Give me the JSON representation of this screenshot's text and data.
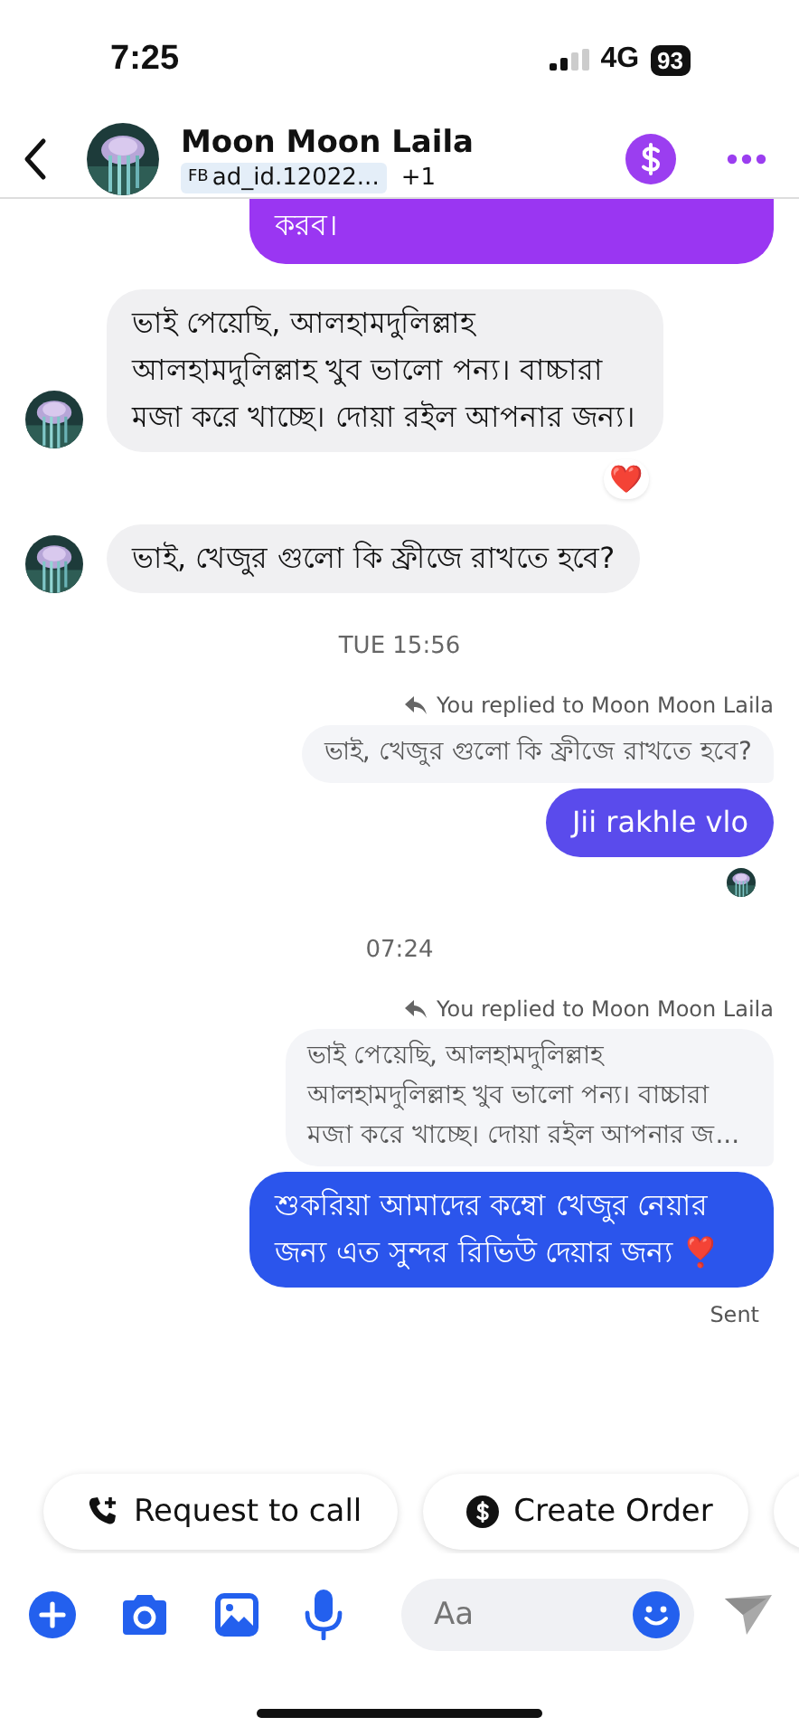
{
  "status_bar": {
    "time": "7:25",
    "network": "4G",
    "battery": "93"
  },
  "header": {
    "name": "Moon Moon Laila",
    "tag_prefix": "FB",
    "tag": "ad_id.12022...",
    "extra": "+1"
  },
  "messages": [
    {
      "kind": "outgoing",
      "text": "করব।",
      "color": "#9a36f2",
      "cut_top": true
    },
    {
      "kind": "incoming",
      "text": "ভাই পেয়েছি, আলহামদুলিল্লাহ আলহামদুলিল্লাহ খুব ভালো পন্য। বাচ্চারা মজা করে খাচ্ছে। দোয়া রইল আপনার জন্য।",
      "reaction": "❤️"
    },
    {
      "kind": "incoming",
      "text": "ভাই, খেজুর গুলো কি ফ্রীজে রাখতে হবে?"
    },
    {
      "kind": "timestamp",
      "text": "TUE 15:56"
    },
    {
      "kind": "reply_label",
      "text": "You replied to Moon Moon Laila"
    },
    {
      "kind": "quote",
      "text": "ভাই, খেজুর গুলো কি ফ্রীজে রাখতে হবে?"
    },
    {
      "kind": "outgoing",
      "text": "Jii rakhle vlo",
      "color": "#5a4bec"
    },
    {
      "kind": "seen"
    },
    {
      "kind": "timestamp",
      "text": "07:24"
    },
    {
      "kind": "reply_label",
      "text": "You replied to Moon Moon Laila"
    },
    {
      "kind": "quote",
      "text": "ভাই পেয়েছি, আলহামদুলিল্লাহ আলহামদুলিল্লাহ খুব ভালো পন্য। বাচ্চারা মজা করে খাচ্ছে। দোয়া রইল আপনার জ..."
    },
    {
      "kind": "outgoing",
      "text": "শুকরিয়া আমাদের কম্বো খেজুর নেয়ার জন্য এত সুন্দর রিভিউ দেয়ার জন্য ❣️",
      "color": "#2b55ec"
    },
    {
      "kind": "status",
      "text": "Sent"
    }
  ],
  "quick_replies": [
    {
      "label": "Request to call",
      "kind": "call"
    },
    {
      "label": "Create Order",
      "kind": "order"
    }
  ],
  "composer": {
    "placeholder": "Aa"
  }
}
